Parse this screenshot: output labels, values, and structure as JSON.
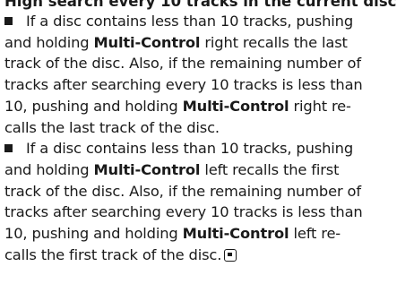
{
  "heading": "High search every 10 tracks in the current disc",
  "bullet_1": {
    "line_1": "If a disc contains less than 10 tracks, pushing",
    "line_2_a": "and holding ",
    "line_2_bold": "Multi-Control",
    "line_2_b": " right recalls the last",
    "line_3": "track of the disc. Also, if the remaining number of",
    "line_4": "tracks after searching every 10 tracks is less than",
    "line_5_a": "10, pushing and holding ",
    "line_5_bold": "Multi-Control",
    "line_5_b": " right re-",
    "line_6": "calls the last track of the disc."
  },
  "bullet_2": {
    "line_1": "If a disc contains less than 10 tracks, pushing",
    "line_2_a": "and holding ",
    "line_2_bold": "Multi-Control",
    "line_2_b": " left recalls the first",
    "line_3": "track of the disc. Also, if the remaining number of",
    "line_4": "tracks after searching every 10 tracks is less than",
    "line_5_a": "10, pushing and holding ",
    "line_5_bold": "Multi-Control",
    "line_5_b": " left re-",
    "line_6": "calls the first track of the disc."
  },
  "icons": {
    "bullet": "square-bullet-icon",
    "end": "end-of-section-icon"
  }
}
